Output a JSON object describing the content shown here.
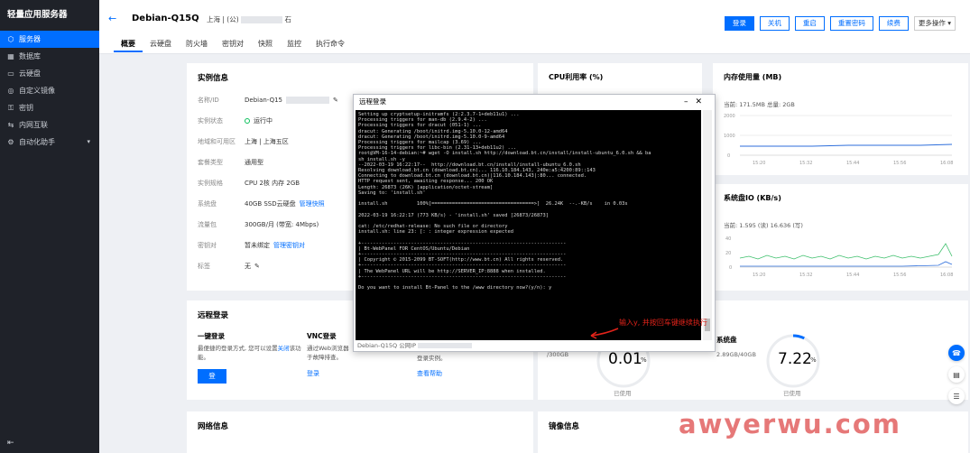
{
  "sidebar": {
    "brand": "轻量应用服务器",
    "items": [
      {
        "label": "服务器",
        "icon": "server-icon",
        "active": true
      },
      {
        "label": "数据库",
        "icon": "database-icon"
      },
      {
        "label": "云硬盘",
        "icon": "disk-icon"
      },
      {
        "label": "自定义镜像",
        "icon": "image-icon"
      },
      {
        "label": "密钥",
        "icon": "key-icon"
      },
      {
        "label": "内网互联",
        "icon": "network-icon"
      },
      {
        "label": "自动化助手",
        "icon": "automation-icon",
        "has_children": true
      }
    ]
  },
  "header": {
    "title": "Debian-Q15Q",
    "region_prefix": "上海 | (公)",
    "region_suffix": "石",
    "actions": [
      "登录",
      "关机",
      "重启",
      "重置密码",
      "续费",
      "更多操作"
    ],
    "tabs": [
      "概要",
      "云硬盘",
      "防火墙",
      "密钥对",
      "快照",
      "监控",
      "执行命令"
    ]
  },
  "instance": {
    "title": "实例信息",
    "rows": [
      {
        "label": "名称/ID",
        "value": "Debian-Q15"
      },
      {
        "label": "实例状态",
        "value": "运行中"
      },
      {
        "label": "地域和可用区",
        "value": "上海 | 上海五区"
      },
      {
        "label": "套餐类型",
        "value": "通用型"
      },
      {
        "label": "实例规格",
        "value": "CPU 2核 内存 2GB"
      },
      {
        "label": "系统盘",
        "value": "40GB SSD云硬盘",
        "link": "管理快照"
      },
      {
        "label": "流量包",
        "value": "300GB/月 (带宽: 4Mbps)"
      },
      {
        "label": "密钥对",
        "value": "暂未绑定",
        "link": "管理密钥对"
      },
      {
        "label": "标签",
        "value": "无"
      }
    ]
  },
  "metrics": {
    "cpu": {
      "title": "CPU利用率 (%)"
    },
    "memory": {
      "title": "内存使用量 (MB)",
      "stat": "当前: 171.5MB 总量: 2GB",
      "ticks_x": [
        "15:20",
        "15:32",
        "15:44",
        "15:56",
        "16:08"
      ],
      "ticks_y": [
        "0",
        "1000",
        "2000"
      ]
    },
    "disk_io": {
      "title": "系统盘IO (KB/s)",
      "stat": "当前: 1.595 (读) 16.636 (写)",
      "ticks_x": [
        "15:20",
        "15:32",
        "15:44",
        "15:56",
        "16:08"
      ],
      "ticks_y": [
        "0",
        "20",
        "40"
      ]
    }
  },
  "remote": {
    "title": "远程登录",
    "one_click_title": "一键登录",
    "one_click_desc": "最便捷的登录方式, 您可以设置",
    "one_click_link": "关闭",
    "one_click_desc2": "该功能。",
    "login_btn": "登录",
    "vnc_title": "VNC登录",
    "vnc_desc1": "通过Web浏览器",
    "vnc_desc2": "于故障排查。",
    "vnc_link": "登录",
    "help_desc": "登录实例。",
    "help_link": "查看帮助"
  },
  "usage": {
    "sys_disk_title": "系统盘",
    "sys_disk_stat": "2.89GB/40GB",
    "left_stat": "/300GB",
    "left_val": "0.01",
    "left_unit": "%",
    "right_val": "7.22",
    "right_unit": "%",
    "sub": "已使用"
  },
  "network": {
    "title": "网络信息"
  },
  "mirror": {
    "title": "镜像信息"
  },
  "terminal": {
    "title": "远程登录",
    "footer": "Debian-Q15Q 公网IP",
    "lines": [
      "Setting up cryptsetup-initramfs (2:2.3.7-1+deb11u1) ...",
      "Processing triggers for man-db (2.9.4-2) ...",
      "Processing triggers for dracut (051-1) ...",
      "dracut: Generating /boot/initrd.img-5.10.0-12-amd64",
      "dracut: Generating /boot/initrd.img-5.10.0-9-amd64",
      "Processing triggers for mailcap (3.69) ...",
      "Processing triggers for libc-bin (2.31-13+deb11u2) ...",
      "root@VM-16-14-debian:~# wget -O install.sh http://download.bt.cn/install/install-ubuntu_6.0.sh && ba",
      "sh install.sh -y",
      "--2022-03-19 16:22:17--  http://download.bt.cn/install/install-ubuntu_6.0.sh",
      "Resolving download.bt.cn (download.bt.cn)... 116.10.184.143, 240e:a5:4200:89::143",
      "Connecting to download.bt.cn (download.bt.cn)|116.10.184.143|:80... connected.",
      "HTTP request sent, awaiting response... 200 OK",
      "Length: 26873 (26K) [application/octet-stream]",
      "Saving to: 'install.sh'",
      "",
      "install.sh          100%[===================================>]  26.24K  --.-KB/s    in 0.03s",
      "",
      "2022-03-19 16:22:17 (773 KB/s) - 'install.sh' saved [26873/26873]",
      "",
      "cat: /etc/redhat-release: No such file or directory",
      "install.sh: line 23: [: : integer expression expected",
      "",
      "+----------------------------------------------------------------------",
      "| Bt-WebPanel FOR CentOS/Ubuntu/Debian",
      "+----------------------------------------------------------------------",
      "| Copyright © 2015-2099 BT-SOFT(http://www.bt.cn) All rights reserved.",
      "+----------------------------------------------------------------------",
      "| The WebPanel URL will be http://SERVER_IP:8888 when installed.",
      "+----------------------------------------------------------------------",
      "",
      "Do you want to install Bt-Panel to the /www directory now?(y/n): y"
    ]
  },
  "annotation": "输入y, 并按回车键继续执行",
  "watermark": "awyerwu.com",
  "colors": {
    "accent": "#006eff",
    "sidebar_bg": "#1f2229",
    "annotation": "#e2231a",
    "ok": "#0abf5b"
  }
}
